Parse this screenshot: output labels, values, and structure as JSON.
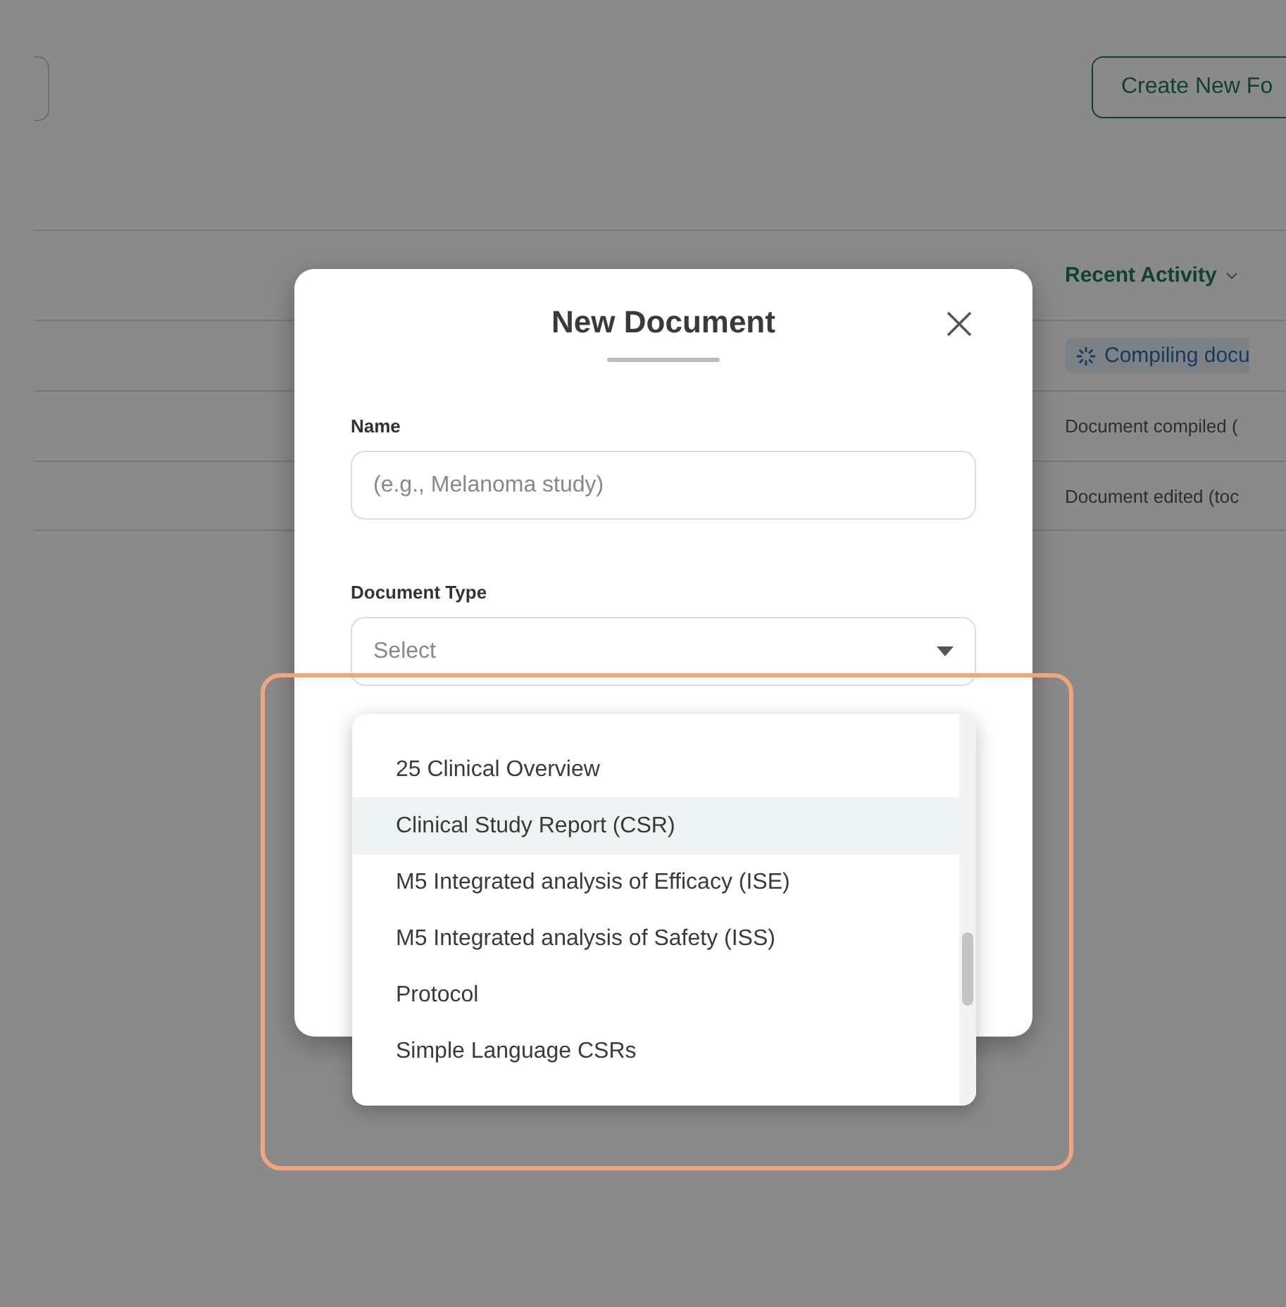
{
  "page": {
    "create_button": "Create New Fo",
    "table": {
      "header": "Recent Activity",
      "rows": [
        {
          "kind": "status",
          "text": "Compiling docu"
        },
        {
          "kind": "plain",
          "text": "Document compiled ("
        },
        {
          "kind": "plain",
          "text": "Document edited (toc"
        }
      ]
    }
  },
  "dialog": {
    "title": "New Document",
    "name_label": "Name",
    "name_placeholder": "(e.g., Melanoma study)",
    "type_label": "Document Type",
    "type_placeholder": "Select",
    "options": [
      {
        "label": "25 Clinical Overview",
        "selected": false
      },
      {
        "label": "Clinical Study Report (CSR)",
        "selected": true
      },
      {
        "label": "M5 Integrated analysis of Efficacy (ISE)",
        "selected": false
      },
      {
        "label": "M5 Integrated analysis of Safety (ISS)",
        "selected": false
      },
      {
        "label": "Protocol",
        "selected": false
      },
      {
        "label": "Simple Language CSRs",
        "selected": false
      }
    ]
  }
}
